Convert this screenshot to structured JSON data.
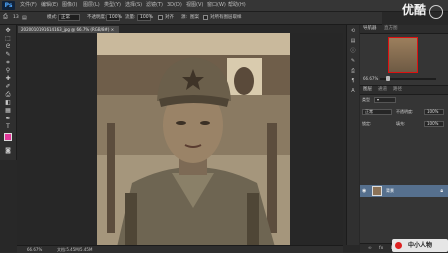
{
  "app": {
    "logo": "Ps",
    "menu": [
      "文件(F)",
      "编辑(E)",
      "图像(I)",
      "图层(L)",
      "类型(Y)",
      "选择(S)",
      "滤镜(T)",
      "3D(D)",
      "视图(V)",
      "窗口(W)",
      "帮助(H)"
    ],
    "video_watermark": "优酷"
  },
  "options": {
    "size": "13",
    "mode_label": "模式:",
    "mode_value": "正常",
    "opacity_label": "不透明度:",
    "opacity_value": "100%",
    "flow_label": "流量:",
    "flow_value": "100%",
    "sample_label": "对所有图层取样",
    "aligned_label": "对齐",
    "source_label": "源:",
    "pattern_label": "图案"
  },
  "document": {
    "tab_title": "2020010191614163_jpg @ 66.7% (RGB/8#) ×",
    "close": "×"
  },
  "status": {
    "zoom": "66.67%",
    "doc": "文档:5.45M/5.45M"
  },
  "navigator": {
    "tabs": [
      "导航器",
      "直方图"
    ],
    "zoom": "66.67%"
  },
  "layers": {
    "tabs": [
      "图层",
      "通道",
      "路径"
    ],
    "kind_label": "类型",
    "blend_mode": "正常",
    "opacity_label": "不透明度:",
    "opacity_value": "100%",
    "lock_label": "锁定:",
    "fill_label": "填充:",
    "fill_value": "100%",
    "layer_name": "背景",
    "footer_icons": [
      "link-icon",
      "fx-icon",
      "mask-icon",
      "adjust-icon",
      "folder-icon",
      "new-layer-icon",
      "trash-icon"
    ]
  },
  "site_logo": "中小人物",
  "colors": {
    "foreground": "#e0399a",
    "background": "#d0d0d0",
    "selected_layer": "#56708e"
  }
}
